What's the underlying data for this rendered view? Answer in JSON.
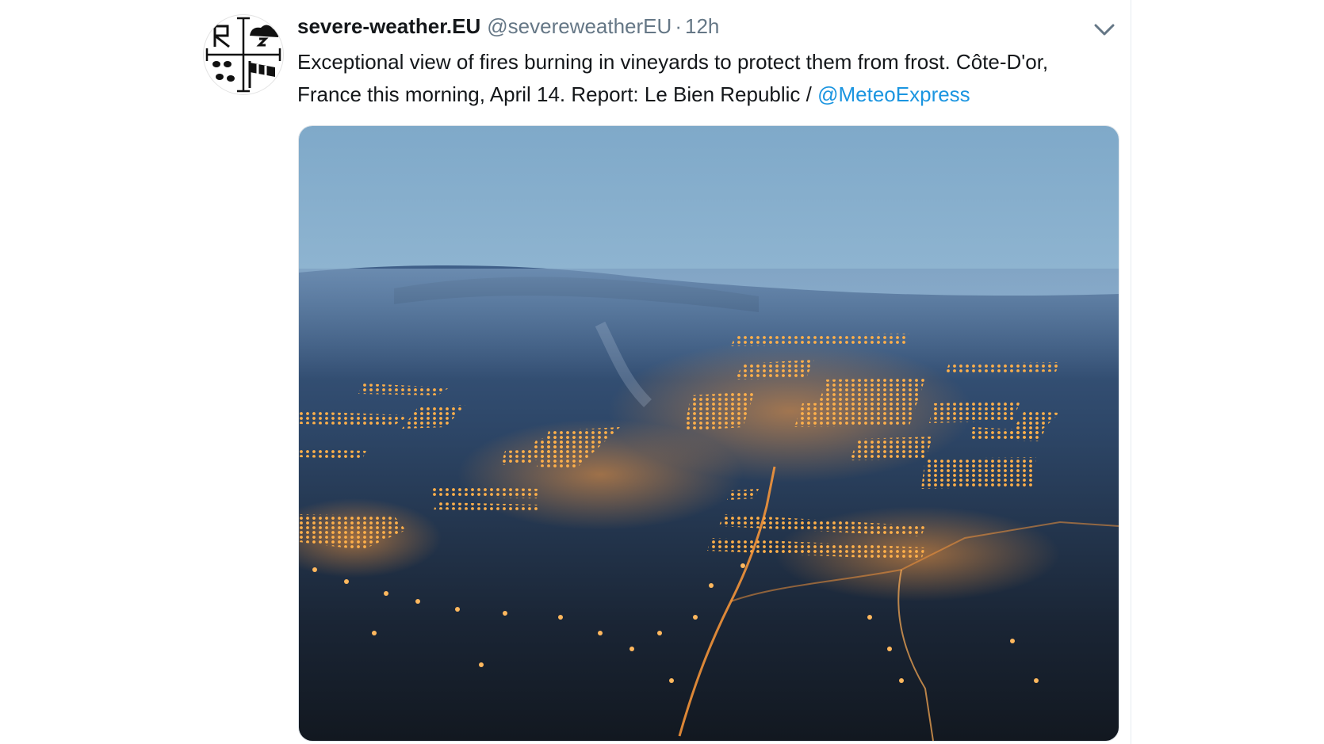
{
  "tweet": {
    "display_name": "severe-weather.EU",
    "handle": "@severeweatherEU",
    "separator": "·",
    "time": "12h",
    "text": "Exceptional view of fires burning in vineyards to protect them from frost. Côte-D'or, France this morning, April 14. Report: Le Bien Republic / ",
    "mention": "@MeteoExpress",
    "avatar_icon": "severe-weather-logo-icon",
    "menu_icon": "chevron-down-icon",
    "media_alt": "aerial photo of vineyards with frost-protection fires at dawn"
  },
  "colors": {
    "name": "#14171a",
    "secondary": "#657786",
    "link": "#1b95e0"
  }
}
